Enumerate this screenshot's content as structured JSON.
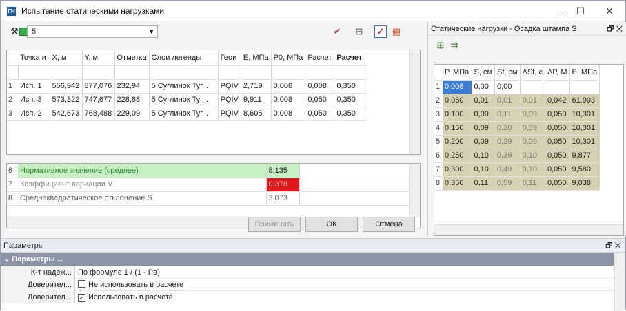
{
  "window": {
    "app_icon": "ГН",
    "title": "Испытание статическими нагрузками",
    "min": "—",
    "max": "☐",
    "close": "✕"
  },
  "toolbar": {
    "combo_value": "5",
    "combo_arrow": "▼"
  },
  "grid1": {
    "headers": [
      "Точка и",
      "X, м",
      "Y, м",
      "Отметка",
      "Слои легенды",
      "Геои",
      "E, МПа",
      "P0, МПа",
      "Расчет",
      "Расчет"
    ],
    "rows": [
      {
        "n": "1",
        "cells": [
          "Исп. 1",
          "556,942",
          "877,076",
          "232,94",
          "5 Суглинок Туг...",
          "PQIV",
          "2,719",
          "0,008",
          "0,008",
          "0,350"
        ]
      },
      {
        "n": "2",
        "cells": [
          "Исп. 3",
          "573,322",
          "747,677",
          "228,88",
          "5 Суглинок Туг...",
          "PQIV",
          "9,911",
          "0,008",
          "0,050",
          "0,350"
        ]
      },
      {
        "n": "3",
        "cells": [
          "Исп. 2",
          "542,673",
          "768,488",
          "229,09",
          "5 Суглинок Туг...",
          "PQIV",
          "8,605",
          "0,008",
          "0,050",
          "0,350"
        ]
      }
    ]
  },
  "grid2": {
    "rows": [
      {
        "n": "6",
        "label": "Нормативное значение (среднее)",
        "value": "8,135"
      },
      {
        "n": "7",
        "label": "Коэффициент вариации V",
        "value": "0,378"
      },
      {
        "n": "8",
        "label": "Среднеквадратическое отклонение S",
        "value": "3,073"
      }
    ],
    "colors": {
      "green": "#c8f0c4",
      "red": "#e0181b"
    }
  },
  "buttons": {
    "apply": "Применить",
    "ok": "ОК",
    "cancel": "Отмена"
  },
  "right": {
    "title": "Статические нагрузки - Осадка штампа S",
    "pin": "🗗 ✕",
    "headers": [
      "P, МПа",
      "S, см",
      "Sf, см",
      "ΔSf, с",
      "ΔP, М",
      "E, МПа"
    ],
    "rows": [
      {
        "n": "1",
        "c": [
          "0,008",
          "0,00",
          "0,00",
          "",
          "",
          ""
        ]
      },
      {
        "n": "2",
        "c": [
          "0,050",
          "0,01",
          "0,01",
          "0,01",
          "0,042",
          "61,903"
        ]
      },
      {
        "n": "3",
        "c": [
          "0,100",
          "0,09",
          "0,11",
          "0,09",
          "0,050",
          "10,301"
        ]
      },
      {
        "n": "4",
        "c": [
          "0,150",
          "0,09",
          "0,20",
          "0,09",
          "0,050",
          "10,301"
        ]
      },
      {
        "n": "5",
        "c": [
          "0,200",
          "0,09",
          "0,29",
          "0,09",
          "0,050",
          "10,301"
        ]
      },
      {
        "n": "6",
        "c": [
          "0,250",
          "0,10",
          "0,39",
          "0,10",
          "0,050",
          "9,877"
        ]
      },
      {
        "n": "7",
        "c": [
          "0,300",
          "0,10",
          "0,49",
          "0,10",
          "0,050",
          "9,580"
        ]
      },
      {
        "n": "8",
        "c": [
          "0,350",
          "0,11",
          "0,59",
          "0,11",
          "0,050",
          "9,038"
        ]
      }
    ]
  },
  "params": {
    "title": "Параметры",
    "pin": "🗗 ✕",
    "category": "Параметры ...",
    "rows": [
      {
        "k": "К-т надеж...",
        "v": "По формуле 1 / (1 - Pa)",
        "cb": ""
      },
      {
        "k": "Доверител...",
        "v": "Не использовать в расчете",
        "cb": "unchecked"
      },
      {
        "k": "Доверител...",
        "v": "Использовать в расчете",
        "cb": "checked"
      }
    ]
  }
}
